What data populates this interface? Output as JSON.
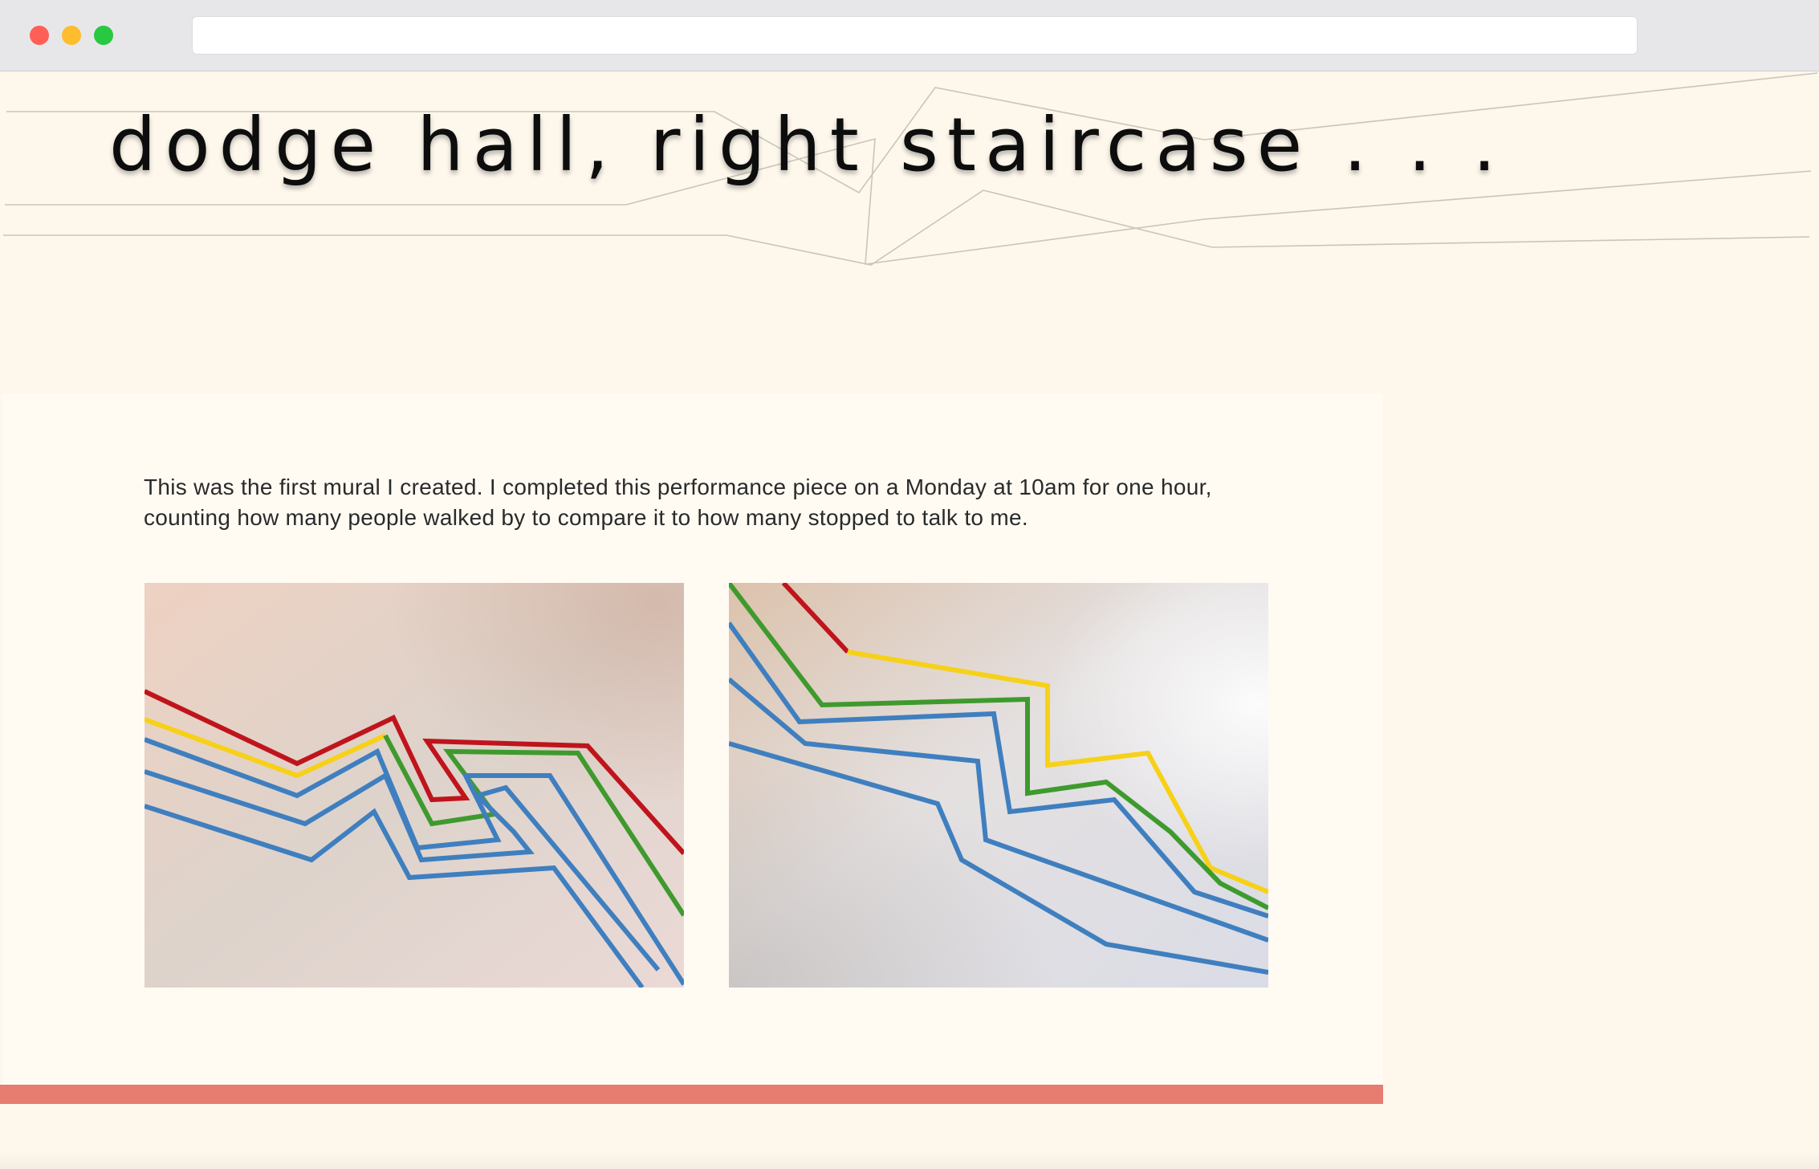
{
  "browser": {
    "url": ""
  },
  "site": {
    "title": "dodge hall, right staircase . . ."
  },
  "content": {
    "intro": "This was the first mural I created. I completed this performance piece on a Monday at 10am for one hour, counting how many people walked by to compare it to how many stopped to talk to me."
  },
  "colors": {
    "accent_bar": "#e77c70",
    "page_bg": "#fdf7ec",
    "card_bg": "#fffbf3",
    "tape_red": "#c0141c",
    "tape_yellow": "#f6d117",
    "tape_green": "#3f9a2e",
    "tape_blue": "#3f7fbf"
  }
}
